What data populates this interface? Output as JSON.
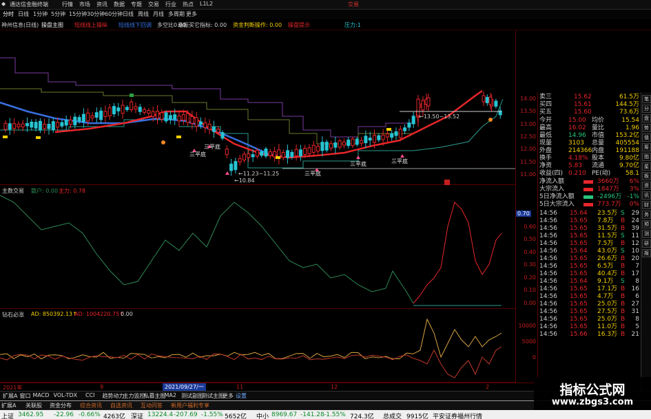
{
  "window": {
    "title": "通达信金融终端",
    "right_label": "交易"
  },
  "menu": {
    "items": [
      "分时",
      "日线",
      "1分钟",
      "5分钟",
      "15分钟",
      "30分钟",
      "60分钟",
      "日线",
      "周线",
      "月线",
      "多周期",
      "更多"
    ],
    "top": [
      "行情",
      "市场",
      "资讯",
      "数据",
      "专题",
      "交易",
      "行业",
      "热点",
      "L1L2"
    ]
  },
  "indicator_bar": {
    "stock": "神州信息(日线)",
    "main_label": "操盘主图",
    "items": [
      "短线线上操纵",
      "短线线下回调",
      "多空比0.00",
      "谐振买它指标: 0.00",
      "资金判断操作: 0.00",
      "操盘提示",
      "压力:1"
    ]
  },
  "colors": {
    "up": "#e8262a",
    "down": "#27c3d3",
    "bg": "#000000",
    "grid": "#5a0000",
    "yellow": "#f5d000",
    "blue": "#3870e0",
    "green": "#2e8b57"
  },
  "price_axis": [
    "14.00",
    "13.50",
    "13.00",
    "12.50",
    "12.00",
    "11.50",
    "11.00"
  ],
  "price_annotations": {
    "low": "10.84",
    "range1": "11.23~11.25",
    "range2": "13.50~13.52",
    "flag": "三平底"
  },
  "pane2": {
    "title": "主数交易",
    "sub": [
      "散户: 0.00",
      "主力: 0.78"
    ],
    "axis": [
      "0.70",
      "0.60",
      "0.50",
      "0.40",
      "0.30",
      "0.20",
      "0.10",
      "0.00"
    ]
  },
  "pane3": {
    "title": "钻石必涨",
    "sub": [
      "AD: 850392.13↑",
      "AD: 1004220.75↑",
      "0.00"
    ],
    "axis": [
      "10000",
      "5000",
      "0"
    ]
  },
  "dates": [
    "2021年",
    "9",
    "2021/09/27/一",
    "11",
    "12",
    "2"
  ],
  "quote": {
    "rows": [
      {
        "label": "卖三",
        "price": "15.62",
        "vol": "61.5万"
      },
      {
        "label": "买四",
        "price": "15.61",
        "vol": "144.5万"
      },
      {
        "label": "买五",
        "price": "15.60",
        "vol": "73.6万"
      }
    ],
    "stats": [
      {
        "l": "今开",
        "v": "15.00",
        "l2": "均价",
        "v2": "15.54"
      },
      {
        "l": "最高",
        "v": "16.02",
        "l2": "量比",
        "v2": "1.96"
      },
      {
        "l": "最低",
        "v": "14.96",
        "l2": "市值",
        "v2": "153.2亿"
      },
      {
        "l": "现量",
        "v": "3103",
        "l2": "总量",
        "v2": "405554"
      },
      {
        "l": "外盘",
        "v": "214366",
        "l2": "内盘",
        "v2": "191188"
      },
      {
        "l": "换手",
        "v": "4.18%",
        "l2": "股本",
        "v2": "9.80亿"
      },
      {
        "l": "净资",
        "v": "5.83",
        "l2": "流通",
        "v2": "9.70亿"
      },
      {
        "l": "收益(四)",
        "v": "0.210",
        "l2": "PE(动)",
        "v2": "58.1"
      }
    ],
    "flows": [
      {
        "l": "净流入额",
        "v": "3660万",
        "p": "6%"
      },
      {
        "l": "大宗流入",
        "v": "1847万",
        "p": "3%"
      },
      {
        "l": "5日净流入额",
        "v": "-2496万",
        "p": "-1%"
      },
      {
        "l": "5日大宗流入",
        "v": "773.7万",
        "p": "0%"
      }
    ],
    "ticks": [
      {
        "t": "14:56",
        "p": "15.64",
        "v": "23.5万",
        "s": "S",
        "n": "29"
      },
      {
        "t": "14:56",
        "p": "15.65",
        "v": "7.8万",
        "s": "B",
        "n": "24"
      },
      {
        "t": "14:56",
        "p": "15.65",
        "v": "31.5万",
        "s": "B",
        "n": "39"
      },
      {
        "t": "14:56",
        "p": "15.65",
        "v": "11.5万",
        "s": "S",
        "n": "11"
      },
      {
        "t": "14:56",
        "p": "15.65",
        "v": "7.5万",
        "s": "B",
        "n": "12"
      },
      {
        "t": "14:56",
        "p": "15.64",
        "v": "43.0万",
        "s": "S",
        "n": "10"
      },
      {
        "t": "14:56",
        "p": "15.65",
        "v": "26.6万",
        "s": "B",
        "n": "20"
      },
      {
        "t": "14:56",
        "p": "15.65",
        "v": "6.5万",
        "s": "B",
        "n": "7"
      },
      {
        "t": "14:56",
        "p": "15.65",
        "v": "40.4万",
        "s": "B",
        "n": "17"
      },
      {
        "t": "14:56",
        "p": "15.64",
        "v": "9.1万",
        "s": "S",
        "n": "8"
      },
      {
        "t": "14:56",
        "p": "15.65",
        "v": "17.1万",
        "s": "B",
        "n": "16"
      },
      {
        "t": "14:56",
        "p": "15.65",
        "v": "4.7万",
        "s": "B",
        "n": "6"
      },
      {
        "t": "14:56",
        "p": "15.65",
        "v": "25.0万",
        "s": "B",
        "n": "27"
      },
      {
        "t": "14:56",
        "p": "15.65",
        "v": "27.5万",
        "s": "B",
        "n": "31"
      },
      {
        "t": "14:56",
        "p": "15.65",
        "v": "25.0万",
        "s": "B",
        "n": "8"
      },
      {
        "t": "14:56",
        "p": "15.65",
        "v": "11.0万",
        "s": "B",
        "n": "5"
      },
      {
        "t": "14:56",
        "p": "15.66",
        "v": "16.3万",
        "s": "B",
        "n": "21"
      }
    ],
    "panel_value": "0.70"
  },
  "right_strip": [
    "笔",
    "分",
    "盘",
    "势",
    "值",
    "筹",
    "指",
    "星",
    "板",
    "资",
    "讯",
    "财",
    "务",
    "预",
    "测",
    "研",
    "报"
  ],
  "bottom_tabs": [
    "扩展A",
    "窗口",
    "MACD",
    "VOL-TDX",
    "CCI",
    "趋势动力",
    "主力监控",
    "私募主图",
    "MA2",
    "测试副图",
    "测试主图",
    "更多",
    "设置"
  ],
  "bottom_tabs2": [
    "扩展A",
    "关联股",
    "资金分布",
    "综合资讯",
    "自选资讯",
    "互动问答",
    "新用户福利专享"
  ],
  "status": {
    "shz": {
      "l": "上证",
      "v": "3462.95",
      "c": "-22.96",
      "p": "-0.66%",
      "a": "4263亿"
    },
    "szz": {
      "l": "深证",
      "v": "13224.4",
      "c": "-207.69",
      "p": "-1.55%",
      "a": "5652亿"
    },
    "zx": {
      "l": "中小",
      "v": "8969.67",
      "c": "-141.28",
      "p": "-1.55%",
      "a": "724.3亿"
    },
    "total": {
      "l": "总成交",
      "v": "9915亿"
    },
    "broker": "平安证券福州行情"
  },
  "watermark": {
    "title": "指标公式网",
    "url": "www.zbgs3.com"
  }
}
